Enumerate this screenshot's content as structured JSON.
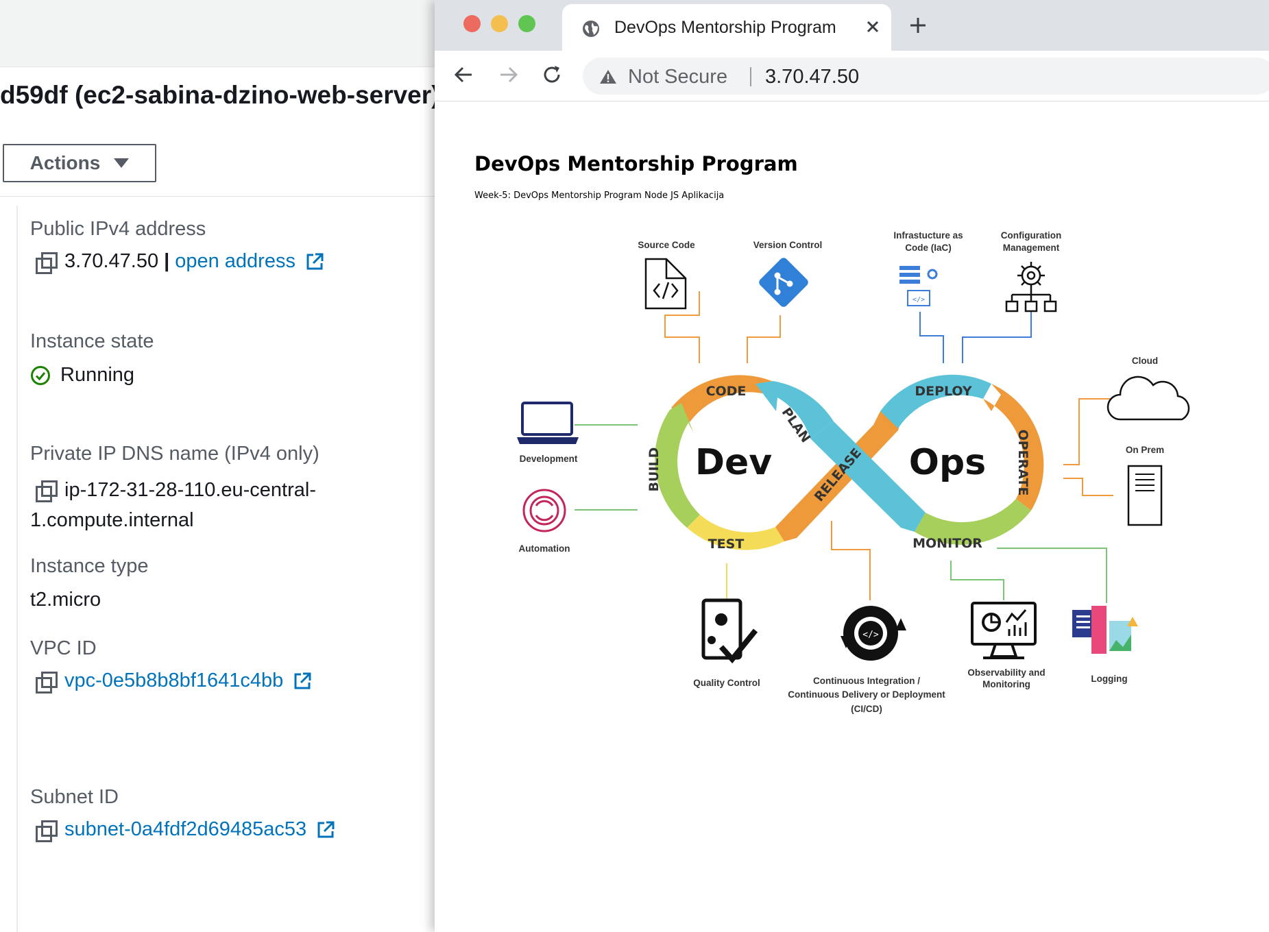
{
  "aws": {
    "instance_title": "d59df (ec2-sabina-dzino-web-server)",
    "actions_label": "Actions",
    "public_ip": {
      "label": "Public IPv4 address",
      "value": "3.70.47.50",
      "separator": "|",
      "link": "open address"
    },
    "instance_state": {
      "label": "Instance state",
      "value": "Running"
    },
    "private_dns": {
      "label": "Private IP DNS name (IPv4 only)",
      "value_line1": "ip-172-31-28-110.eu-central-",
      "value_line2": "1.compute.internal"
    },
    "instance_type": {
      "label": "Instance type",
      "value": "t2.micro"
    },
    "vpc": {
      "label": "VPC ID",
      "value": "vpc-0e5b8b8bf1641c4bb"
    },
    "subnet": {
      "label": "Subnet ID",
      "value": "subnet-0a4fdf2d69485ac53"
    }
  },
  "browser": {
    "tab_title": "DevOps Mentorship Program",
    "security_label": "Not Secure",
    "url": "3.70.47.50",
    "window_controls": {
      "close": "#ec6a5e",
      "minimize": "#f4bf4f",
      "maximize": "#61c554"
    }
  },
  "page": {
    "heading": "DevOps Mentorship Program",
    "subheading": "Week-5: DevOps Mentorship Program Node JS Aplikacija",
    "diagram": {
      "center_left": "Dev",
      "center_right": "Ops",
      "segments": {
        "code": "CODE",
        "plan": "PLAN",
        "build": "BUILD",
        "test": "TEST",
        "release": "RELEASE",
        "deploy": "DEPLOY",
        "operate": "OPERATE",
        "monitor": "MONITOR"
      },
      "labels": {
        "source_code": "Source Code",
        "version_control": "Version Control",
        "iac_line1": "Infrastucture as",
        "iac_line2": "Code (IaC)",
        "config_line1": "Configuration",
        "config_line2": "Management",
        "cloud": "Cloud",
        "on_prem": "On Prem",
        "development": "Development",
        "automation": "Automation",
        "quality_control": "Quality Control",
        "cicd_line1": "Continuous Integration /",
        "cicd_line2": "Continuous Delivery or Deployment",
        "cicd_line3": "(CI/CD)",
        "observability_line1": "Observability and",
        "observability_line2": "Monitoring",
        "logging": "Logging"
      },
      "colors": {
        "orange": "#ee9a3a",
        "blue": "#5bc2d8",
        "green": "#a6cf5c",
        "yellow": "#f5dc58",
        "line_blue": "#3b7dd8",
        "line_green": "#7cc576"
      }
    }
  }
}
